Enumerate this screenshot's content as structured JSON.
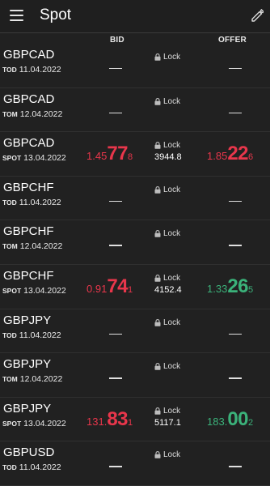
{
  "header": {
    "title": "Spot",
    "menu_icon": "hamburger-menu-icon",
    "edit_icon": "pencil-icon"
  },
  "columns": {
    "bid": "BID",
    "offer": "OFFER"
  },
  "colors": {
    "bid": "#e8364b",
    "offer_up": "#3bb27a",
    "offer_down": "#e8364b"
  },
  "lock_label": "Lock",
  "rows": [
    {
      "pair": "GBPCAD",
      "tenor": "TOD",
      "date": "11.04.2022"
    },
    {
      "pair": "GBPCAD",
      "tenor": "TOM",
      "date": "12.04.2022"
    },
    {
      "pair": "GBPCAD",
      "tenor": "SPOT",
      "date": "13.04.2022",
      "bid_a": "1.45",
      "bid_b": "77",
      "bid_c": "8",
      "size": "3944.8",
      "offer_a": "1.85",
      "offer_b": "22",
      "offer_c": "6",
      "offer_color": "red"
    },
    {
      "pair": "GBPCHF",
      "tenor": "TOD",
      "date": "11.04.2022"
    },
    {
      "pair": "GBPCHF",
      "tenor": "TOM",
      "date": "12.04.2022"
    },
    {
      "pair": "GBPCHF",
      "tenor": "SPOT",
      "date": "13.04.2022",
      "bid_a": "0.91",
      "bid_b": "74",
      "bid_c": "1",
      "size": "4152.4",
      "offer_a": "1.33",
      "offer_b": "26",
      "offer_c": "5",
      "offer_color": "green"
    },
    {
      "pair": "GBPJPY",
      "tenor": "TOD",
      "date": "11.04.2022"
    },
    {
      "pair": "GBPJPY",
      "tenor": "TOM",
      "date": "12.04.2022"
    },
    {
      "pair": "GBPJPY",
      "tenor": "SPOT",
      "date": "13.04.2022",
      "bid_a": "131.",
      "bid_b": "83",
      "bid_c": "1",
      "size": "5117.1",
      "offer_a": "183.",
      "offer_b": "00",
      "offer_c": "2",
      "offer_color": "green"
    },
    {
      "pair": "GBPUSD",
      "tenor": "TOD",
      "date": "11.04.2022"
    }
  ]
}
